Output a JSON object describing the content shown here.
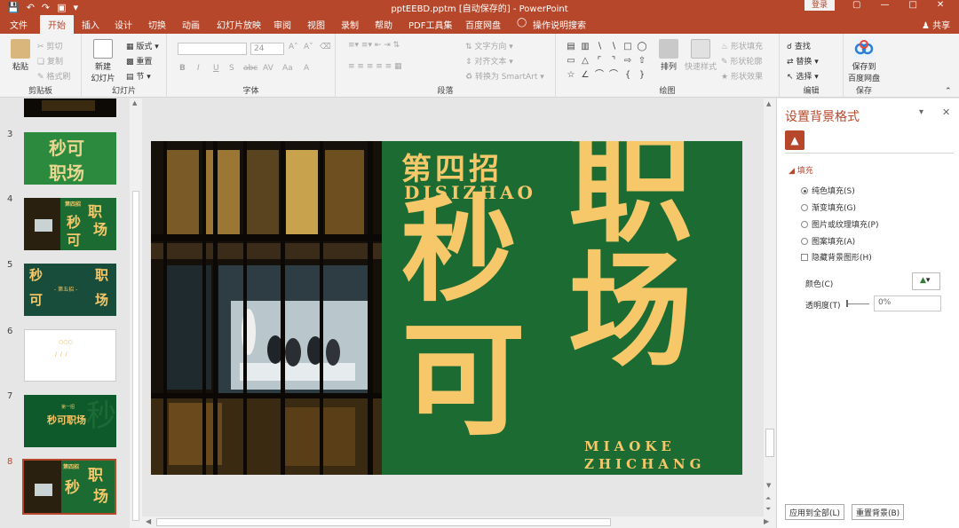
{
  "titlebar": {
    "document_title": "pptEEBD.pptm [自动保存的] - PowerPoint",
    "login_label": "登录",
    "qat_icons": [
      "save-icon",
      "undo-icon",
      "redo-icon",
      "present-icon",
      "customize-icon"
    ]
  },
  "tabs": [
    "文件",
    "开始",
    "插入",
    "设计",
    "切换",
    "动画",
    "幻灯片放映",
    "审阅",
    "视图",
    "录制",
    "帮助",
    "PDF工具集",
    "百度网盘",
    "操作说明搜索"
  ],
  "active_tab": "开始",
  "share_label": "共享",
  "ribbon": {
    "clipboard": {
      "paste": "粘贴",
      "cut": "剪切",
      "copy": "复制",
      "format_painter": "格式刷",
      "label": "剪贴板"
    },
    "slides": {
      "new_slide_line1": "新建",
      "new_slide_line2": "幻灯片",
      "layout": "版式",
      "reset": "重置",
      "section": "节",
      "label": "幻灯片"
    },
    "font": {
      "size_value": "24",
      "buttons": [
        "B",
        "I",
        "U",
        "S",
        "abc",
        "AV",
        "Aa",
        "A"
      ],
      "label": "字体"
    },
    "paragraph": {
      "text_direction": "文字方向",
      "align_text": "对齐文本",
      "smartart": "转换为 SmartArt",
      "label": "段落"
    },
    "drawing": {
      "arrange": "排列",
      "quick_styles": "快速样式",
      "shape_fill": "形状填充",
      "shape_outline": "形状轮廓",
      "shape_effects": "形状效果",
      "label": "绘图"
    },
    "editing": {
      "find": "查找",
      "replace": "替换",
      "select": "选择",
      "label": "编辑"
    },
    "save": {
      "line1": "保存到",
      "line2": "百度网盘",
      "label": "保存"
    }
  },
  "thumbnails": [
    {
      "number": "3",
      "title_line1": "秒可",
      "title_line2": "职场"
    },
    {
      "number": "4",
      "text": "第四招 职场 秒可"
    },
    {
      "number": "5",
      "text": "秒 职 可 场 第五招"
    },
    {
      "number": "6",
      "text": ""
    },
    {
      "number": "7",
      "text": "秒可职场"
    },
    {
      "number": "8",
      "text": "第四招 职 秒 场"
    }
  ],
  "slide": {
    "heading_cn": "第四招",
    "heading_pinyin": "DISIZHAO",
    "big_char_1": "职",
    "big_char_2": "秒",
    "big_char_3": "场",
    "big_char_4": "可",
    "footer_line1": "MIAOKE",
    "footer_line2": "ZHICHANG"
  },
  "pane": {
    "title": "设置背景格式",
    "section": "填充",
    "options": [
      "纯色填充(S)",
      "渐变填充(G)",
      "图片或纹理填充(P)",
      "图案填充(A)"
    ],
    "selected_option": 0,
    "hide_background": "隐藏背景图形(H)",
    "color_label": "颜色(C)",
    "transparency_label": "透明度(T)",
    "transparency_value": "0%",
    "apply_all": "应用到全部(L)",
    "reset_bg": "重置背景(B)"
  },
  "colors": {
    "accent": "#b7472a",
    "slide_green": "#1b6b32",
    "slide_gold": "#f6c86a"
  }
}
